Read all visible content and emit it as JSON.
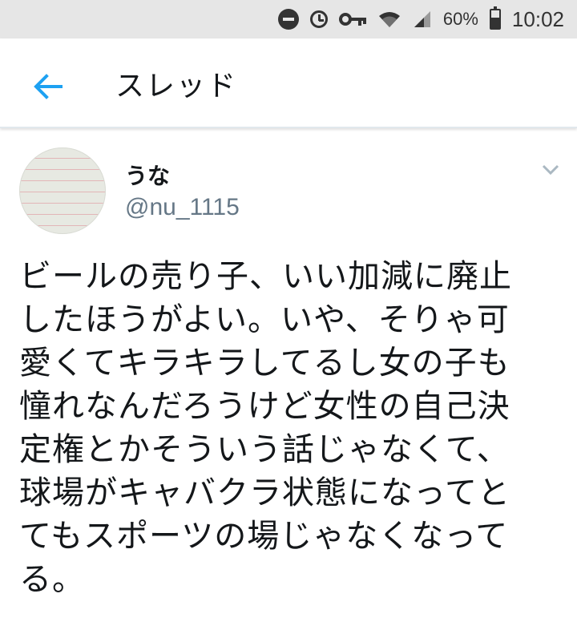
{
  "status_bar": {
    "battery_percent": "60%",
    "time": "10:02",
    "icons": [
      "do-not-disturb-icon",
      "alarm-icon",
      "vpn-key-icon",
      "wifi-icon",
      "signal-icon",
      "battery-icon"
    ]
  },
  "app_bar": {
    "title": "スレッド",
    "back_icon": "back-arrow-icon",
    "accent_color": "#1da1f2"
  },
  "tweet": {
    "display_name": "うな",
    "handle": "@nu_1115",
    "menu_icon": "chevron-down-icon",
    "text_lines": [
      "ビールの売り子、いい加減に廃止",
      "したほうがよい。いや、そりゃ可",
      "愛くてキラキラしてるし女の子も",
      "憧れなんだろうけど女性の自己決",
      "定権とかそういう話じゃなくて、",
      "球場がキャバクラ状態になってと",
      "てもスポーツの場じゃなくなって",
      "る。"
    ]
  }
}
